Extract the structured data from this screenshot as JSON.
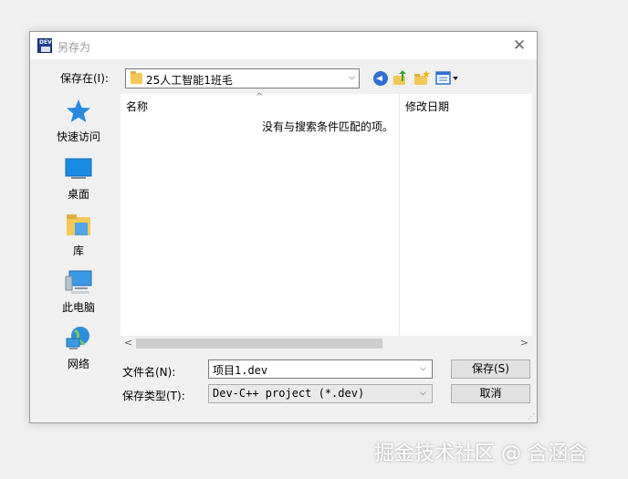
{
  "window": {
    "title": "另存为",
    "close_icon": "close-icon"
  },
  "save_in": {
    "label": "保存在(I):",
    "value": "25人工智能1班毛"
  },
  "toolbar": {
    "back_icon": "back-icon",
    "up_icon": "up-folder-icon",
    "new_folder_icon": "new-folder-icon",
    "view_icon": "view-menu-icon"
  },
  "places": [
    {
      "label": "快速访问",
      "icon": "star-icon"
    },
    {
      "label": "桌面",
      "icon": "desktop-icon"
    },
    {
      "label": "库",
      "icon": "library-icon"
    },
    {
      "label": "此电脑",
      "icon": "computer-icon"
    },
    {
      "label": "网络",
      "icon": "network-icon"
    }
  ],
  "file_list": {
    "columns": [
      "名称",
      "修改日期"
    ],
    "empty_message": "没有与搜索条件匹配的项。"
  },
  "filename": {
    "label": "文件名(N):",
    "value": "项目1.dev"
  },
  "filetype": {
    "label": "保存类型(T):",
    "value": "Dev-C++ project (*.dev)"
  },
  "buttons": {
    "save": "保存(S)",
    "cancel": "取消"
  },
  "watermark": "掘金技术社区 @ 含涵含",
  "colors": {
    "accent_blue": "#2e6fd0",
    "folder_yellow": "#f3c857",
    "dialog_bg": "#f0f0f0"
  }
}
